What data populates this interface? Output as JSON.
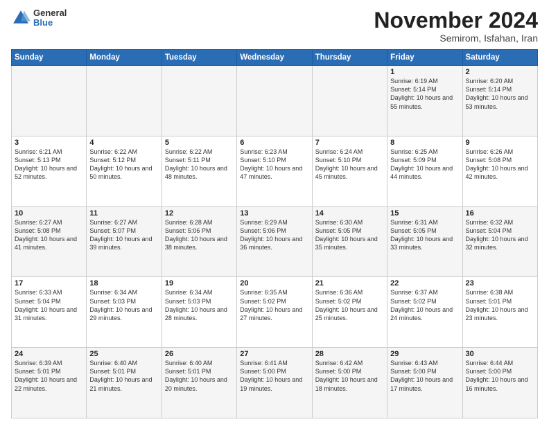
{
  "header": {
    "logo_general": "General",
    "logo_blue": "Blue",
    "month_title": "November 2024",
    "location": "Semirom, Isfahan, Iran"
  },
  "days_of_week": [
    "Sunday",
    "Monday",
    "Tuesday",
    "Wednesday",
    "Thursday",
    "Friday",
    "Saturday"
  ],
  "weeks": [
    [
      {
        "day": "",
        "info": ""
      },
      {
        "day": "",
        "info": ""
      },
      {
        "day": "",
        "info": ""
      },
      {
        "day": "",
        "info": ""
      },
      {
        "day": "",
        "info": ""
      },
      {
        "day": "1",
        "info": "Sunrise: 6:19 AM\nSunset: 5:14 PM\nDaylight: 10 hours and 55 minutes."
      },
      {
        "day": "2",
        "info": "Sunrise: 6:20 AM\nSunset: 5:14 PM\nDaylight: 10 hours and 53 minutes."
      }
    ],
    [
      {
        "day": "3",
        "info": "Sunrise: 6:21 AM\nSunset: 5:13 PM\nDaylight: 10 hours and 52 minutes."
      },
      {
        "day": "4",
        "info": "Sunrise: 6:22 AM\nSunset: 5:12 PM\nDaylight: 10 hours and 50 minutes."
      },
      {
        "day": "5",
        "info": "Sunrise: 6:22 AM\nSunset: 5:11 PM\nDaylight: 10 hours and 48 minutes."
      },
      {
        "day": "6",
        "info": "Sunrise: 6:23 AM\nSunset: 5:10 PM\nDaylight: 10 hours and 47 minutes."
      },
      {
        "day": "7",
        "info": "Sunrise: 6:24 AM\nSunset: 5:10 PM\nDaylight: 10 hours and 45 minutes."
      },
      {
        "day": "8",
        "info": "Sunrise: 6:25 AM\nSunset: 5:09 PM\nDaylight: 10 hours and 44 minutes."
      },
      {
        "day": "9",
        "info": "Sunrise: 6:26 AM\nSunset: 5:08 PM\nDaylight: 10 hours and 42 minutes."
      }
    ],
    [
      {
        "day": "10",
        "info": "Sunrise: 6:27 AM\nSunset: 5:08 PM\nDaylight: 10 hours and 41 minutes."
      },
      {
        "day": "11",
        "info": "Sunrise: 6:27 AM\nSunset: 5:07 PM\nDaylight: 10 hours and 39 minutes."
      },
      {
        "day": "12",
        "info": "Sunrise: 6:28 AM\nSunset: 5:06 PM\nDaylight: 10 hours and 38 minutes."
      },
      {
        "day": "13",
        "info": "Sunrise: 6:29 AM\nSunset: 5:06 PM\nDaylight: 10 hours and 36 minutes."
      },
      {
        "day": "14",
        "info": "Sunrise: 6:30 AM\nSunset: 5:05 PM\nDaylight: 10 hours and 35 minutes."
      },
      {
        "day": "15",
        "info": "Sunrise: 6:31 AM\nSunset: 5:05 PM\nDaylight: 10 hours and 33 minutes."
      },
      {
        "day": "16",
        "info": "Sunrise: 6:32 AM\nSunset: 5:04 PM\nDaylight: 10 hours and 32 minutes."
      }
    ],
    [
      {
        "day": "17",
        "info": "Sunrise: 6:33 AM\nSunset: 5:04 PM\nDaylight: 10 hours and 31 minutes."
      },
      {
        "day": "18",
        "info": "Sunrise: 6:34 AM\nSunset: 5:03 PM\nDaylight: 10 hours and 29 minutes."
      },
      {
        "day": "19",
        "info": "Sunrise: 6:34 AM\nSunset: 5:03 PM\nDaylight: 10 hours and 28 minutes."
      },
      {
        "day": "20",
        "info": "Sunrise: 6:35 AM\nSunset: 5:02 PM\nDaylight: 10 hours and 27 minutes."
      },
      {
        "day": "21",
        "info": "Sunrise: 6:36 AM\nSunset: 5:02 PM\nDaylight: 10 hours and 25 minutes."
      },
      {
        "day": "22",
        "info": "Sunrise: 6:37 AM\nSunset: 5:02 PM\nDaylight: 10 hours and 24 minutes."
      },
      {
        "day": "23",
        "info": "Sunrise: 6:38 AM\nSunset: 5:01 PM\nDaylight: 10 hours and 23 minutes."
      }
    ],
    [
      {
        "day": "24",
        "info": "Sunrise: 6:39 AM\nSunset: 5:01 PM\nDaylight: 10 hours and 22 minutes."
      },
      {
        "day": "25",
        "info": "Sunrise: 6:40 AM\nSunset: 5:01 PM\nDaylight: 10 hours and 21 minutes."
      },
      {
        "day": "26",
        "info": "Sunrise: 6:40 AM\nSunset: 5:01 PM\nDaylight: 10 hours and 20 minutes."
      },
      {
        "day": "27",
        "info": "Sunrise: 6:41 AM\nSunset: 5:00 PM\nDaylight: 10 hours and 19 minutes."
      },
      {
        "day": "28",
        "info": "Sunrise: 6:42 AM\nSunset: 5:00 PM\nDaylight: 10 hours and 18 minutes."
      },
      {
        "day": "29",
        "info": "Sunrise: 6:43 AM\nSunset: 5:00 PM\nDaylight: 10 hours and 17 minutes."
      },
      {
        "day": "30",
        "info": "Sunrise: 6:44 AM\nSunset: 5:00 PM\nDaylight: 10 hours and 16 minutes."
      }
    ]
  ]
}
